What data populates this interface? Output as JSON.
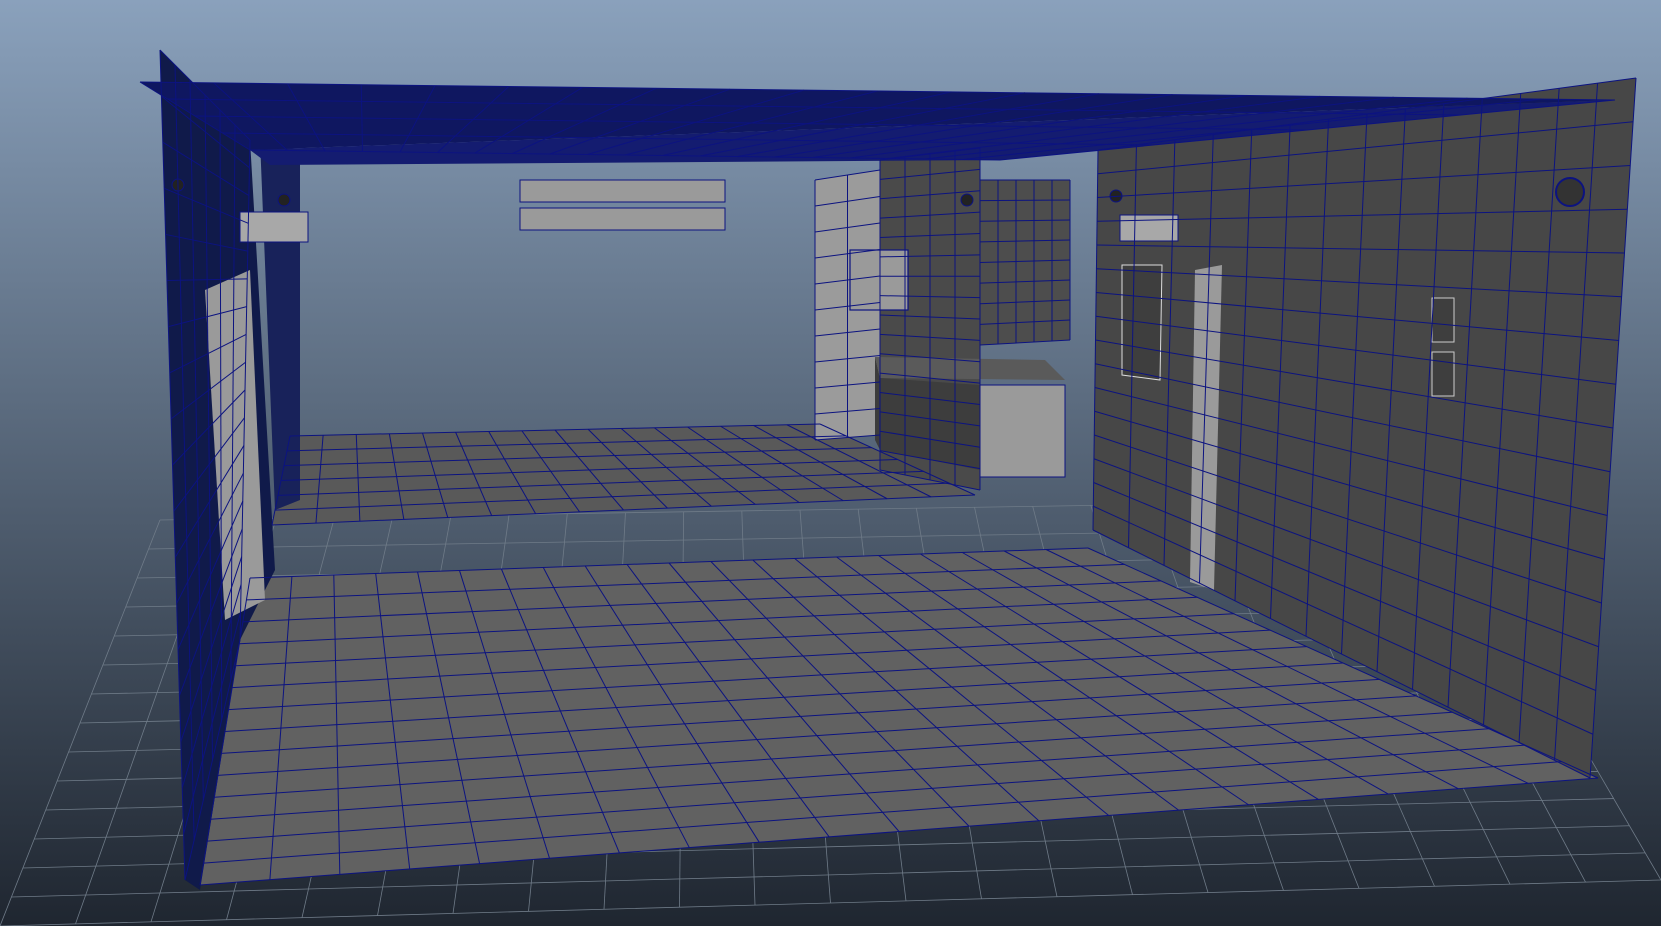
{
  "viewport": {
    "background_top": "#8aa1bc",
    "background_bottom": "#1f2630",
    "shading_mode": "wireframe-on-shaded"
  },
  "colors": {
    "wireframe": "#0c1380",
    "surface_dark": "#404040",
    "surface_mid": "#555555",
    "surface_light": "#9a9a9a",
    "floor": "#616161",
    "ground_grid": "#6f7b88"
  },
  "scene": {
    "objects": [
      "ceiling-slab",
      "left-wall",
      "right-wall",
      "main-floor",
      "back-room-floor",
      "back-room-wall",
      "kitchen-counter",
      "wall-light-fixtures",
      "ceiling-vents",
      "ground-grid"
    ]
  }
}
